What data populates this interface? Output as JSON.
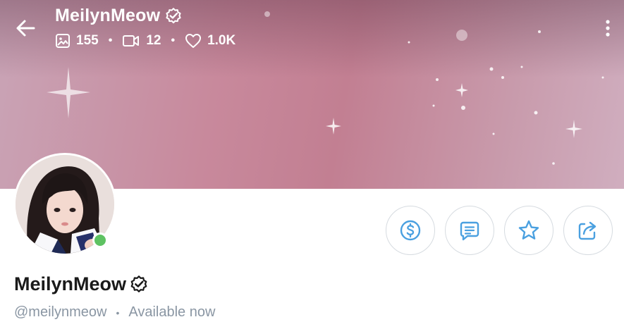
{
  "header": {
    "title": "MeilynMeow",
    "stats": {
      "photos": "155",
      "videos": "12",
      "likes": "1.0K"
    },
    "separator": "•"
  },
  "profile": {
    "name": "MeilynMeow",
    "handle": "@meilynmeow",
    "separator": "•",
    "status": "Available now",
    "online": true
  },
  "actions": [
    {
      "name": "tip",
      "icon": "dollar-circle-icon"
    },
    {
      "name": "message",
      "icon": "message-icon"
    },
    {
      "name": "favorite",
      "icon": "star-icon"
    },
    {
      "name": "share",
      "icon": "share-icon"
    }
  ],
  "colors": {
    "accent": "#00aff0",
    "icon_blue": "#4aa0e0",
    "online": "#5ec262",
    "muted_text": "#8a96a3",
    "banner_pink": "#c8899c"
  }
}
